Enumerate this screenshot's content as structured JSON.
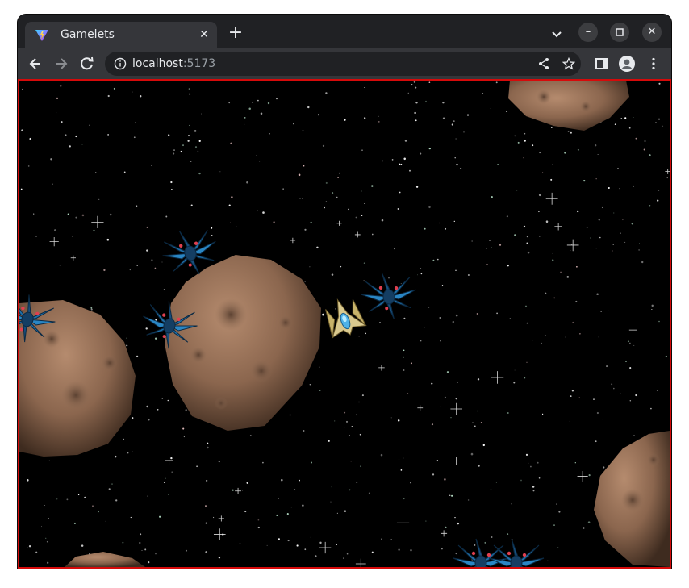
{
  "browser": {
    "tab_title": "Gamelets",
    "url_host": "localhost",
    "url_port": ":5173",
    "icons": [
      "vite-favicon-icon",
      "close-icon",
      "plus-icon",
      "chevron-down-icon",
      "minimize-icon",
      "maximize-icon",
      "close-window-icon",
      "back-arrow-icon",
      "forward-arrow-icon",
      "reload-icon",
      "info-icon",
      "share-icon",
      "star-icon",
      "side-panel-icon",
      "profile-icon",
      "kebab-menu-icon"
    ]
  },
  "game": {
    "border_color": "#d60a0a",
    "background": "#000000",
    "sprites": [
      "player-ship",
      "alien-bug",
      "asteroid",
      "star-field"
    ]
  }
}
